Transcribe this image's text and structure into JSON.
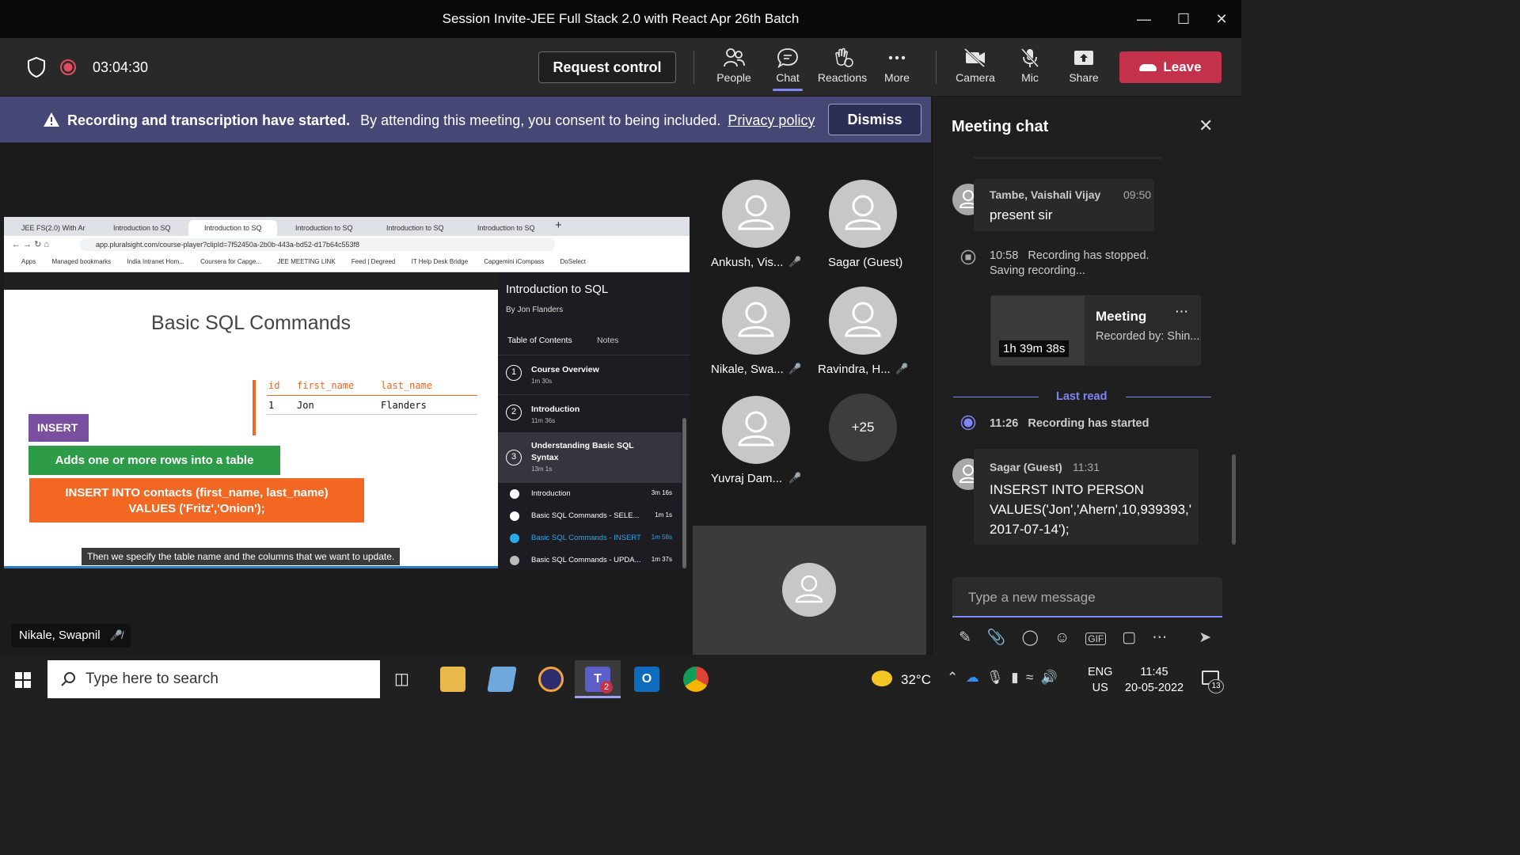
{
  "window": {
    "title": "Session Invite-JEE Full Stack 2.0 with React Apr 26th Batch"
  },
  "toolbar": {
    "timer": "03:04:30",
    "request_control": "Request control",
    "items": [
      "People",
      "Chat",
      "Reactions",
      "More",
      "Camera",
      "Mic",
      "Share"
    ],
    "leave": "Leave"
  },
  "banner": {
    "bold": "Recording and transcription have started.",
    "text": "By attending this meeting, you consent to being included.",
    "link": "Privacy policy",
    "dismiss": "Dismiss"
  },
  "shared_screen": {
    "tabs": [
      "JEE FS(2.0) With Ar",
      "Introduction to SQ",
      "Introduction to SQ",
      "Introduction to SQ",
      "Introduction to SQ",
      "Introduction to SQ"
    ],
    "url": "app.pluralsight.com/course-player?clipId=7f52450a-2b0b-443a-bd52-d17b64c553f8",
    "bookmarks": [
      "Apps",
      "Managed bookmarks",
      "India Intranet Hom...",
      "Coursera for Capge...",
      "JEE MEETING LINK",
      "Feed | Degreed",
      "IT Help Desk Bridge",
      "Capgemini iCompass",
      "DoSelect"
    ],
    "slide": {
      "title": "Basic SQL Commands",
      "table_headers": [
        "id",
        "first_name",
        "last_name"
      ],
      "table_row": [
        "1",
        "Jon",
        "Flanders"
      ],
      "insert_label": "INSERT",
      "green_text": "Adds one or more rows into a table",
      "orange_line1": "INSERT INTO contacts (first_name, last_name)",
      "orange_line2": "VALUES ('Fritz','Onion');",
      "caption": "Then we specify the table name and the columns that we want to update."
    },
    "course": {
      "title": "Introduction to SQL",
      "author": "By Jon Flanders",
      "tabs": [
        "Table of Contents",
        "Notes"
      ],
      "modules": [
        {
          "num": "1",
          "name": "Course Overview",
          "dur": "1m 30s"
        },
        {
          "num": "2",
          "name": "Introduction",
          "dur": "11m 36s"
        },
        {
          "num": "3",
          "name": "Understanding Basic SQL Syntax",
          "dur": "13m 1s"
        }
      ],
      "clips": [
        {
          "name": "Introduction",
          "dur": "3m 16s"
        },
        {
          "name": "Basic SQL Commands - SELE...",
          "dur": "1m 1s"
        },
        {
          "name": "Basic SQL Commands - INSERT",
          "dur": "1m 58s"
        },
        {
          "name": "Basic SQL Commands - UPDA...",
          "dur": "1m 37s"
        }
      ]
    }
  },
  "presenter": "Nikale, Swapnil",
  "participants": [
    "Ankush, Vis...",
    "Sagar (Guest)",
    "Nikale, Swa...",
    "Ravindra, H...",
    "Yuvraj Dam..."
  ],
  "more_count": "+25",
  "chat": {
    "title": "Meeting chat",
    "messages": [
      {
        "author": "Tambe, Vaishali Vijay",
        "time": "09:50",
        "text": "present sir"
      },
      {
        "time": "10:58",
        "event": "Recording has stopped.",
        "event2": "Saving recording..."
      },
      {
        "rec_title": "Meeting",
        "rec_by": "Recorded by: Shin...",
        "rec_dur": "1h 39m 38s"
      },
      {
        "time": "11:26",
        "event": "Recording has started"
      },
      {
        "author": "Sagar (Guest)",
        "time": "11:31",
        "line1": "INSERST INTO PERSON",
        "line2": "VALUES('Jon','Ahern',10,939393,'",
        "line3": "2017-07-14');"
      }
    ],
    "last_read": "Last read",
    "placeholder": "Type a new message"
  },
  "taskbar": {
    "search_placeholder": "Type here to search",
    "weather": "32°C",
    "lang": "ENG",
    "region": "US",
    "time": "11:45",
    "date": "20-05-2022",
    "notif_count": "13",
    "teams_badge": "2"
  }
}
